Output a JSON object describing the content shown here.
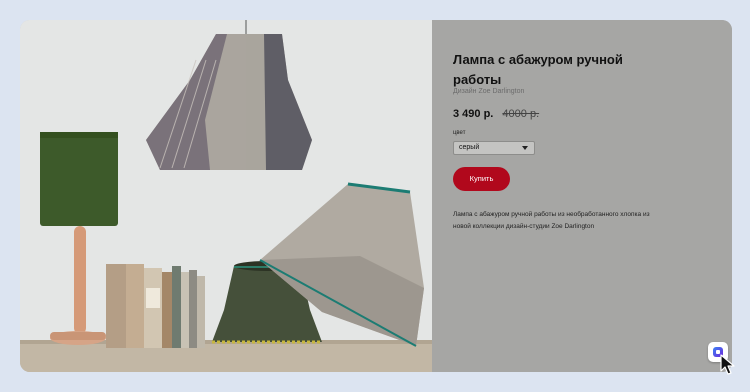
{
  "product": {
    "title": "Лампа с абажуром ручной работы",
    "designer": "Дизайн Zoe Darlington",
    "price_current": "3 490 р.",
    "price_old": "4000 р.",
    "color_label": "цвет",
    "color_value": "серый",
    "buy_label": "Купить",
    "description": "Лампа с абажуром ручной работы из необработанного хлопка из новой коллекции дизайн-студии Zoe Darlington"
  },
  "colors": {
    "page_background": "#dce4f1",
    "panel": "#a6a6a4",
    "buy_button": "#b1081c",
    "lamp_green": "#3d5a2a",
    "lamp_grey": "#a8a39c"
  },
  "icons": {
    "badge": "app-badge-icon",
    "cursor": "mouse-pointer-icon"
  }
}
